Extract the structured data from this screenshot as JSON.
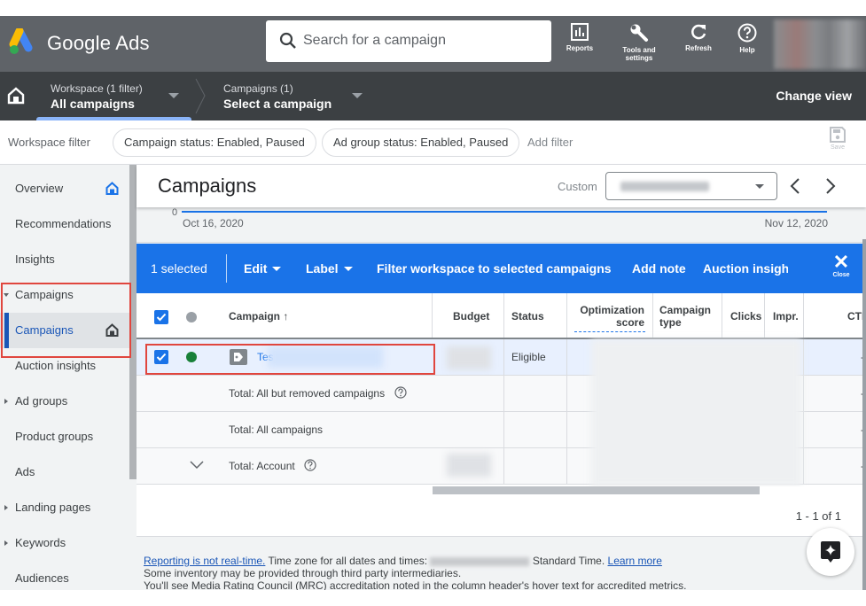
{
  "header": {
    "brand": "Google Ads",
    "search_placeholder": "Search for a campaign",
    "buttons": [
      {
        "label": "Reports",
        "icon": "reports-icon"
      },
      {
        "label": "Tools and settings",
        "icon": "wrench-icon"
      },
      {
        "label": "Refresh",
        "icon": "refresh-icon"
      },
      {
        "label": "Help",
        "icon": "help-icon"
      }
    ]
  },
  "navbar": {
    "workspace_sub": "Workspace (1 filter)",
    "workspace_main": "All campaigns",
    "campaigns_sub": "Campaigns (1)",
    "campaigns_main": "Select a campaign",
    "change_view": "Change view"
  },
  "filterbar": {
    "label": "Workspace filter",
    "chips": [
      "Campaign status: Enabled, Paused",
      "Ad group status: Enabled, Paused"
    ],
    "add_filter": "Add filter",
    "save_label": "Save"
  },
  "sidebar": {
    "items": [
      {
        "label": "Overview",
        "home": true
      },
      {
        "label": "Recommendations"
      },
      {
        "label": "Insights"
      },
      {
        "label": "Campaigns",
        "expanded": true
      },
      {
        "label": "Campaigns",
        "active": true,
        "home": true
      },
      {
        "label": "Auction insights"
      },
      {
        "label": "Ad groups",
        "collapsed": true
      },
      {
        "label": "Product groups"
      },
      {
        "label": "Ads"
      },
      {
        "label": "Landing pages",
        "collapsed": true
      },
      {
        "label": "Keywords",
        "collapsed": true
      },
      {
        "label": "Audiences"
      }
    ]
  },
  "main": {
    "title": "Campaigns",
    "date_range_label": "Custom",
    "chart": {
      "y_zero": "0",
      "start_date": "Oct 16, 2020",
      "end_date": "Nov 12, 2020"
    },
    "selection_bar": {
      "count": "1 selected",
      "edit": "Edit",
      "label": "Label",
      "filter_workspace": "Filter workspace to selected campaigns",
      "add_note": "Add note",
      "auction": "Auction insigh",
      "close": "Close"
    },
    "table": {
      "columns": [
        "Campaign",
        "Budget",
        "Status",
        "Optimization score",
        "Campaign type",
        "Clicks",
        "Impr.",
        "CTR"
      ],
      "column_optimization_1": "Optimization",
      "column_optimization_2": "score",
      "column_type_1": "Campaign",
      "column_type_2": "type",
      "sort_indicator": "↑",
      "rows": [
        {
          "campaign": "Tes",
          "status": "Eligible",
          "ctr": "-",
          "selected": true,
          "status_color": "#188038"
        }
      ],
      "totals": [
        {
          "label": "Total: All but removed campaigns",
          "help": true,
          "ctr": "-"
        },
        {
          "label": "Total: All campaigns",
          "help": false,
          "ctr": "-"
        },
        {
          "label": "Total: Account",
          "help": true,
          "ctr": "-"
        }
      ],
      "pagination": "1 - 1 of 1"
    },
    "footer": {
      "link1": "Reporting is not real-time.",
      "tz_prefix": " Time zone for all dates and times: ",
      "tz_suffix": " Standard Time. ",
      "learn_more": "Learn more",
      "line2": "Some inventory may be provided through third party intermediaries.",
      "line3": "You'll see Media Rating Council (MRC) accreditation noted in the column header's hover text for accredited metrics."
    }
  },
  "colors": {
    "accent": "#1a73e8",
    "header": "#5f6368",
    "navbar": "#3c4043",
    "highlight_box": "#e0463e",
    "status_enabled": "#188038"
  }
}
